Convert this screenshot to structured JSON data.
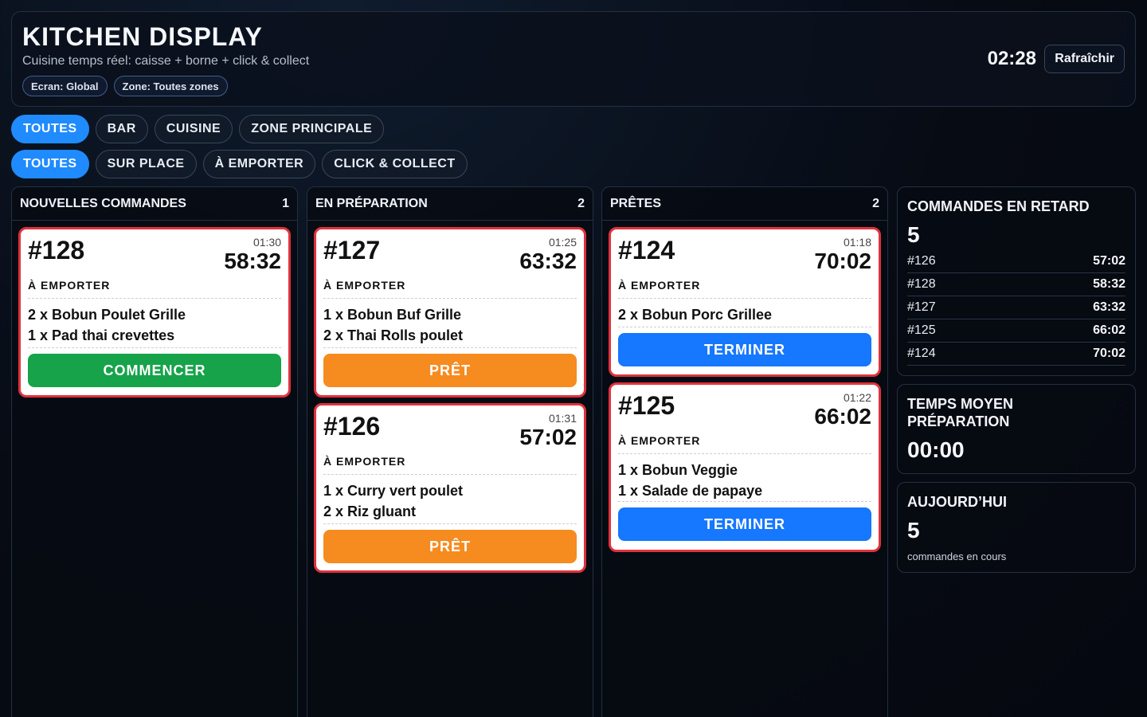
{
  "header": {
    "title": "KITCHEN DISPLAY",
    "subtitle": "Cuisine temps réel: caisse + borne + click & collect",
    "tags": [
      "Ecran: Global",
      "Zone: Toutes zones"
    ],
    "clock": "02:28",
    "refresh_label": "Rafraîchir"
  },
  "filters": {
    "zones": [
      "TOUTES",
      "BAR",
      "CUISINE",
      "ZONE PRINCIPALE"
    ],
    "zone_active": "TOUTES",
    "modes": [
      "TOUTES",
      "SUR PLACE",
      "À EMPORTER",
      "CLICK & COLLECT"
    ],
    "mode_active": "TOUTES"
  },
  "columns": [
    {
      "title": "NOUVELLES COMMANDES",
      "count": "1",
      "orders": [
        {
          "number": "#128",
          "time": "01:30",
          "elapsed": "58:32",
          "type": "À EMPORTER",
          "items": [
            "2 x Bobun Poulet Grille",
            "1 x Pad thai crevettes"
          ],
          "action": "COMMENCER"
        }
      ]
    },
    {
      "title": "EN PRÉPARATION",
      "count": "2",
      "orders": [
        {
          "number": "#127",
          "time": "01:25",
          "elapsed": "63:32",
          "type": "À EMPORTER",
          "items": [
            "1 x Bobun Buf Grille",
            "2 x Thai Rolls poulet"
          ],
          "action": "PRÊT"
        },
        {
          "number": "#126",
          "time": "01:31",
          "elapsed": "57:02",
          "type": "À EMPORTER",
          "items": [
            "1 x Curry vert poulet",
            "2 x Riz gluant"
          ],
          "action": "PRÊT"
        }
      ]
    },
    {
      "title": "PRÊTES",
      "count": "2",
      "orders": [
        {
          "number": "#124",
          "time": "01:18",
          "elapsed": "70:02",
          "type": "À EMPORTER",
          "items": [
            "2 x Bobun Porc Grillee"
          ],
          "action": "TERMINER"
        },
        {
          "number": "#125",
          "time": "01:22",
          "elapsed": "66:02",
          "type": "À EMPORTER",
          "items": [
            "1 x Bobun Veggie",
            "1 x Salade de papaye"
          ],
          "action": "TERMINER"
        }
      ]
    }
  ],
  "late": {
    "title": "COMMANDES EN RETARD",
    "count": "5",
    "rows": [
      {
        "id": "#126",
        "time": "57:02"
      },
      {
        "id": "#128",
        "time": "58:32"
      },
      {
        "id": "#127",
        "time": "63:32"
      },
      {
        "id": "#125",
        "time": "66:02"
      },
      {
        "id": "#124",
        "time": "70:02"
      }
    ]
  },
  "avg": {
    "title_line1": "TEMPS MOYEN",
    "title_line2": "PRÉPARATION",
    "value": "00:00"
  },
  "today": {
    "title": "AUJOURD’HUI",
    "value": "5",
    "caption": "commandes en cours"
  },
  "colors": {
    "accent": "#1f8bff",
    "start": "#16a34a",
    "ready": "#f68b1f",
    "finish": "#1677ff",
    "late_border": "#e0323c"
  }
}
